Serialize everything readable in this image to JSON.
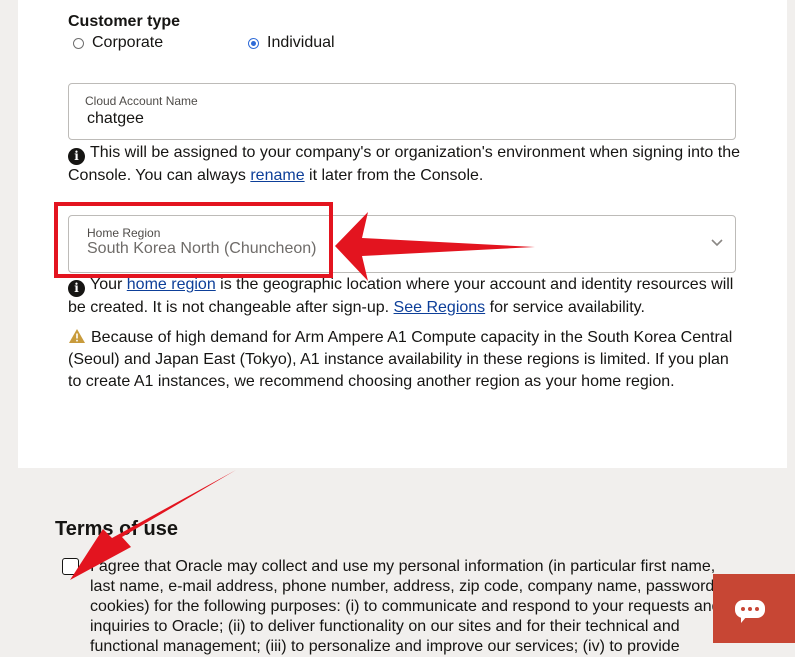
{
  "customer_type": {
    "label": "Customer type",
    "options": [
      {
        "label": "Corporate",
        "selected": false
      },
      {
        "label": "Individual",
        "selected": true
      }
    ]
  },
  "cloud_account": {
    "label": "Cloud Account Name",
    "value": "chatgee",
    "info_before": "This will be assigned to your company's or organization's environment when signing into the Console. You can always ",
    "info_link": "rename",
    "info_after": " it later from the Console."
  },
  "home_region": {
    "label": "Home Region",
    "value": "South Korea North (Chuncheon)",
    "info_1": "Your ",
    "info_link1": "home region",
    "info_2": " is the geographic location where your account and identity resources will be created. It is not changeable after sign-up. ",
    "info_link2": "See Regions",
    "info_3": " for service availability.",
    "warning": "Because of high demand for Arm Ampere A1 Compute capacity in the South Korea Central (Seoul) and Japan East (Tokyo), A1 instance availability in these regions is limited. If you plan to create A1 instances, we recommend choosing another region as your home region."
  },
  "terms": {
    "title": "Terms of use",
    "text": "I agree that Oracle may collect and use my personal information (in particular first name, last name, e-mail address, phone number, address, zip code, company name, password, cookies) for the following purposes: (i) to communicate and respond to your requests and inquiries to Oracle; (ii) to deliver functionality on our sites and for their technical and functional management; (iii) to personalize and improve our services; (iv) to provide"
  },
  "colors": {
    "annotation_red": "#e3141f",
    "chat_button": "#c74634",
    "link": "#0d3f99"
  },
  "icons": [
    "info-icon",
    "warning-icon",
    "chevron-down-icon",
    "chat-icon"
  ]
}
